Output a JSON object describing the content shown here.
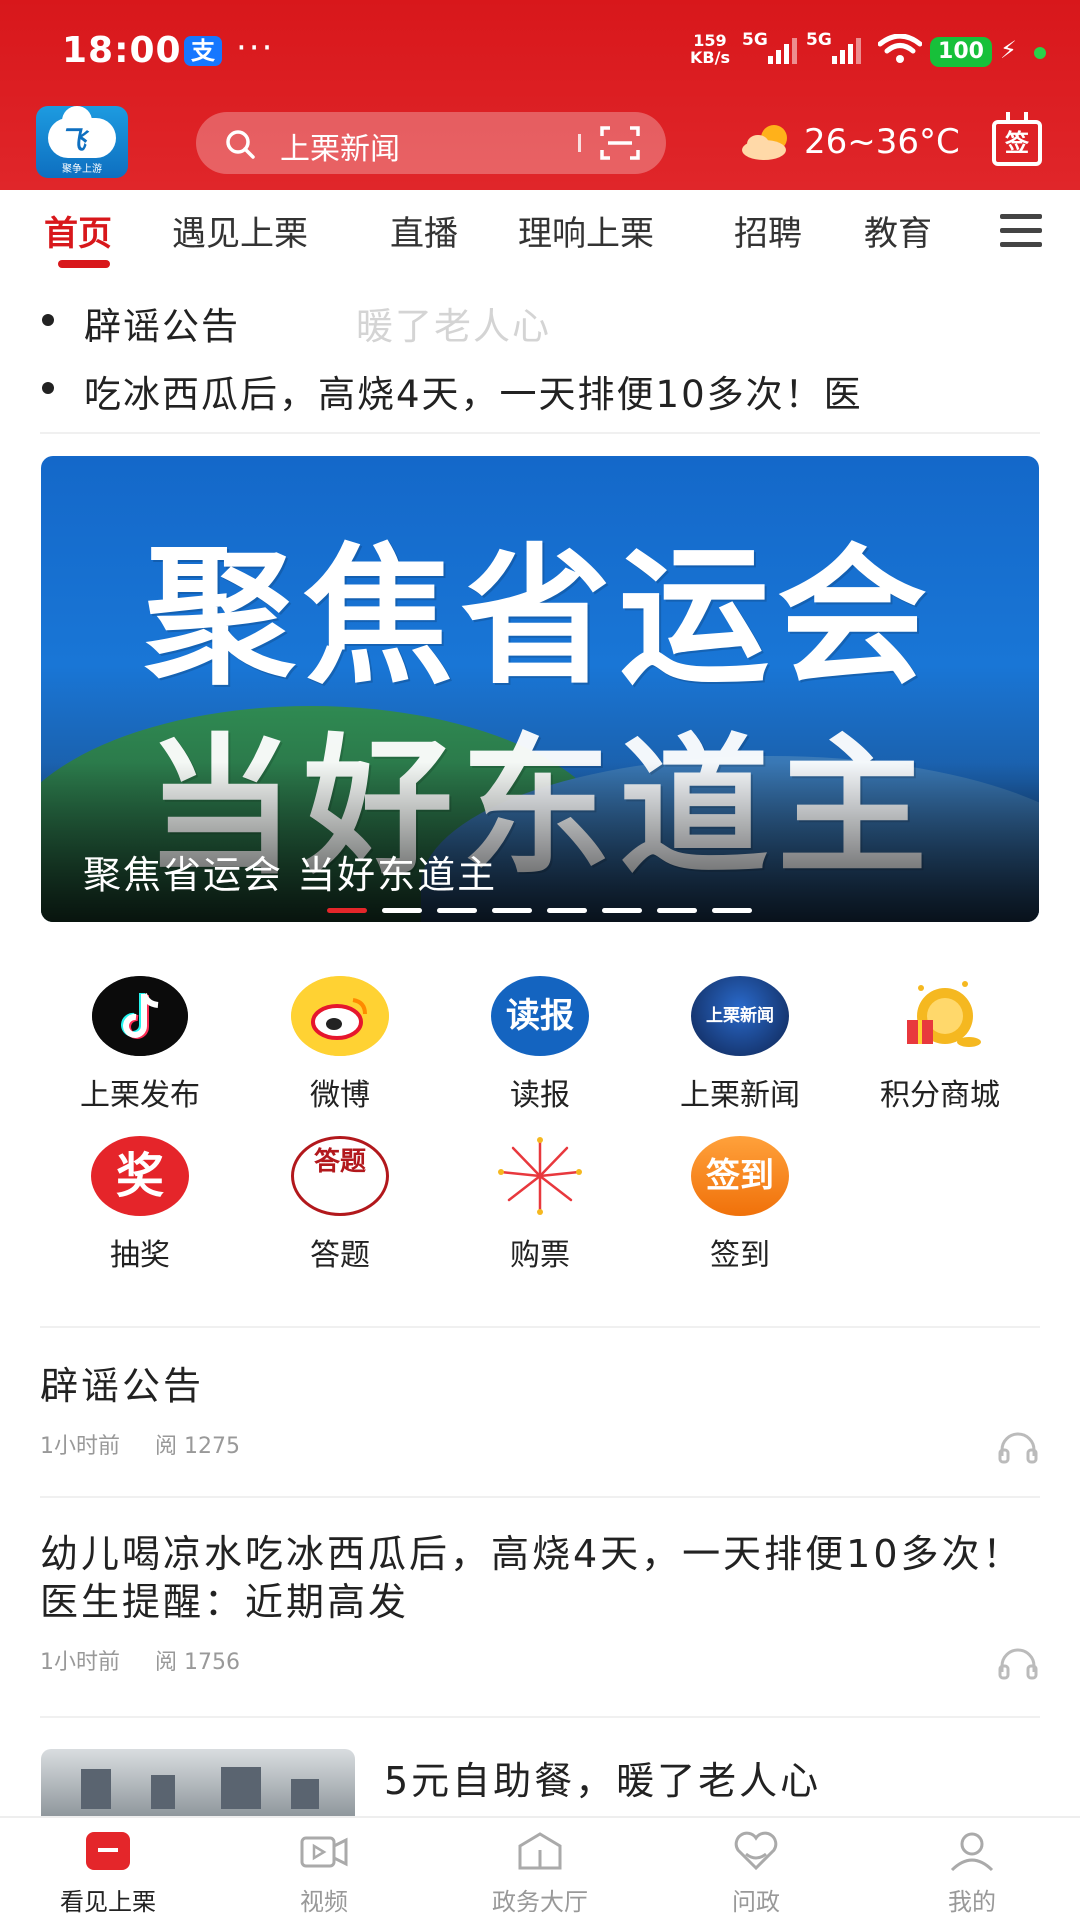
{
  "status_bar": {
    "time": "18:00",
    "alipay_icon": "支",
    "more": "···",
    "speed_value": "159",
    "speed_unit": "KB/s",
    "net1": "5G",
    "net2": "5G",
    "battery": "100"
  },
  "header": {
    "search_placeholder": "上栗新闻",
    "weather": "26~36°C",
    "signin_label": "签",
    "app_logo_text": "聚争上游"
  },
  "tabs": [
    {
      "label": "首页",
      "active": true
    },
    {
      "label": "遇见上栗"
    },
    {
      "label": "直播"
    },
    {
      "label": "理响上栗"
    },
    {
      "label": "招聘"
    },
    {
      "label": "教育"
    }
  ],
  "ticker": {
    "items": [
      "辟谣公告",
      "吃冰西瓜后，高烧4天，一天排便10多次！医"
    ],
    "ghost_text": "暖了老人心"
  },
  "banner": {
    "headline_line1": "聚焦省运会",
    "headline_line2": "当好东道主",
    "caption": "聚焦省运会 当好东道主",
    "slide_count": 8,
    "active_slide": 1
  },
  "shortcuts": [
    {
      "label": "上栗发布",
      "icon": "tiktok-icon"
    },
    {
      "label": "微博",
      "icon": "weibo-icon"
    },
    {
      "label": "读报",
      "icon": "newspaper-icon",
      "glyph": "读报"
    },
    {
      "label": "上栗新闻",
      "icon": "news-icon",
      "glyph": "上栗新闻"
    },
    {
      "label": "积分商城",
      "icon": "gift-mall-icon"
    },
    {
      "label": "抽奖",
      "icon": "lottery-icon",
      "glyph": "奖"
    },
    {
      "label": "答题",
      "icon": "quiz-icon",
      "glyph": "答题"
    },
    {
      "label": "购票",
      "icon": "fireworks-icon"
    },
    {
      "label": "签到",
      "icon": "checkin-icon",
      "glyph": "签到"
    }
  ],
  "articles": [
    {
      "title": "辟谣公告",
      "time": "1小时前",
      "reads": "阅 1275"
    },
    {
      "title": "幼儿喝凉水吃冰西瓜后，高烧4天，一天排便10多次！医生提醒：近期高发",
      "time": "1小时前",
      "reads": "阅 1756"
    },
    {
      "title": "5元自助餐，暖了老人心"
    }
  ],
  "bottom_nav": [
    {
      "label": "看见上栗",
      "active": true
    },
    {
      "label": "视频"
    },
    {
      "label": "政务大厅"
    },
    {
      "label": "问政"
    },
    {
      "label": "我的"
    }
  ],
  "colors": {
    "brand_red": "#d8171b",
    "muted": "#999999"
  }
}
